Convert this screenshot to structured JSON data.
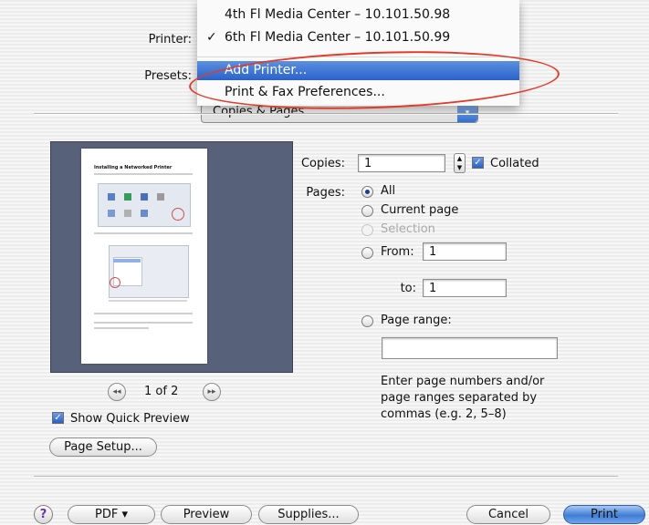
{
  "menu": {
    "items": [
      {
        "label": "4th Fl Media Center – 10.101.50.98",
        "checked": false
      },
      {
        "label": "6th Fl Media Center – 10.101.50.99",
        "checked": true
      },
      {
        "label": "Add Printer...",
        "selected": true
      },
      {
        "label": "Print & Fax Preferences..."
      }
    ],
    "check_glyph": "✓"
  },
  "labels": {
    "printer": "Printer:",
    "presets": "Presets:",
    "copies": "Copies:",
    "pages": "Pages:",
    "to": "to:"
  },
  "panel_popup": {
    "value": "Copies & Pages",
    "arrow": "▾"
  },
  "copies": {
    "value": "1",
    "collated_label": "Collated",
    "collated": true
  },
  "pages": {
    "all": "All",
    "current": "Current page",
    "selection": "Selection",
    "from": "From:",
    "from_value": "1",
    "to_value": "1",
    "page_range": "Page range:",
    "range_value": "",
    "note_1": "Enter page numbers and/or",
    "note_2": "page ranges separated by",
    "note_3": "commas (e.g. 2, 5–8)"
  },
  "preview": {
    "doc_title": "Installing a Networked Printer",
    "page_indicator": "1 of 2",
    "show_quick_preview": "Show Quick Preview",
    "show_quick_preview_checked": true,
    "page_setup": "Page Setup..."
  },
  "footer": {
    "help": "?",
    "pdf": "PDF ▾",
    "preview": "Preview",
    "supplies": "Supplies...",
    "cancel": "Cancel",
    "print": "Print"
  },
  "colors": {
    "accent": "#2b62c8",
    "annotation": "#e23b2a",
    "preview_bg": "#58617a"
  }
}
